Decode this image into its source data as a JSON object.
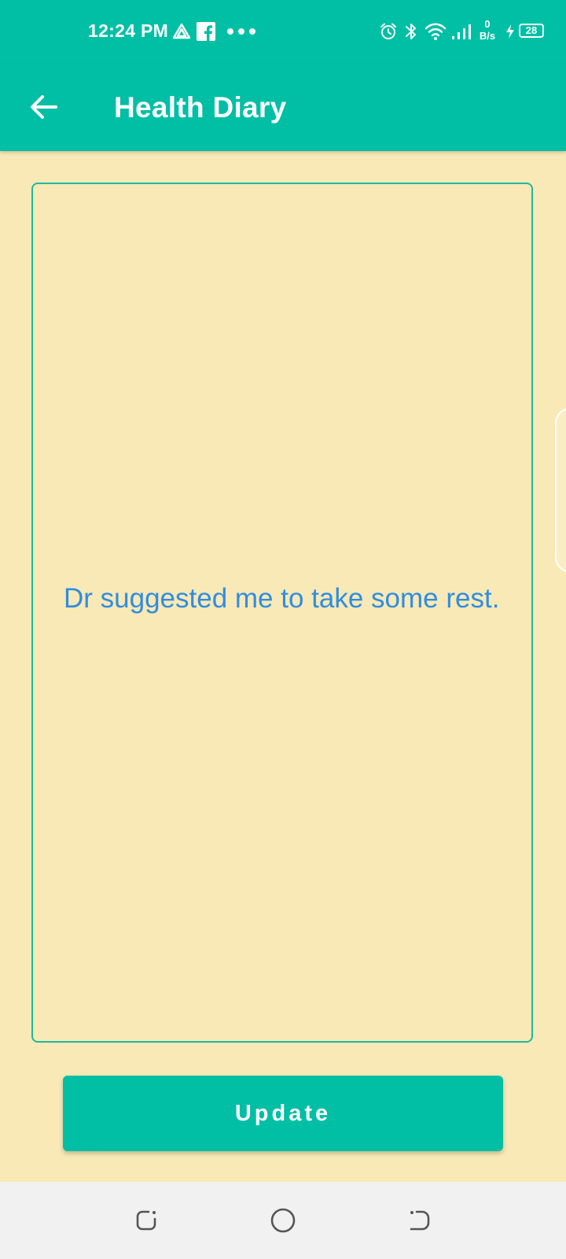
{
  "status_bar": {
    "time": "12:24 PM",
    "network_speed_value": "0",
    "network_speed_unit": "B/s",
    "battery_level": "28",
    "icons": [
      "drive-icon",
      "facebook-icon",
      "more-dots-icon",
      "alarm-icon",
      "bluetooth-icon",
      "wifi-icon",
      "signal-icon",
      "charging-icon",
      "battery-icon"
    ]
  },
  "app_bar": {
    "title": "Health Diary",
    "back_icon": "arrow-left-icon"
  },
  "diary": {
    "text": "Dr suggested me to take some rest."
  },
  "actions": {
    "update_label": "Update"
  },
  "nav_bar": {
    "icons": [
      "recent-apps-icon",
      "home-icon",
      "back-nav-icon"
    ]
  },
  "colors": {
    "primary": "#00BFA5",
    "background": "#F8E9B6",
    "text_accent": "#2F8DE0",
    "nav_background": "#F1F1F1"
  }
}
